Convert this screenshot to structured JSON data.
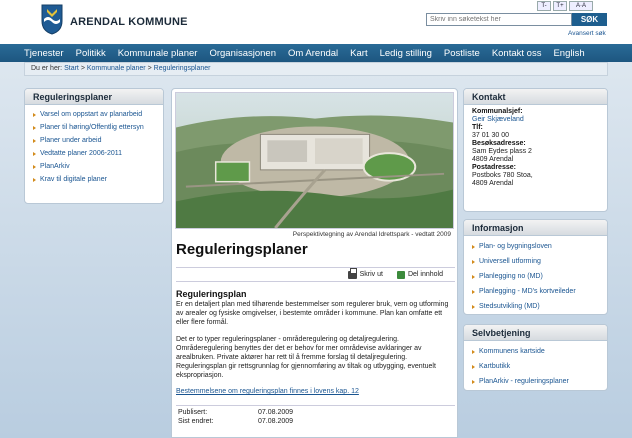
{
  "header": {
    "site_name": "ARENDAL KOMMUNE",
    "font_buttons": [
      "T-",
      "T+",
      "A·A"
    ],
    "search_placeholder": "Skriv inn søketekst her",
    "search_button": "SØK",
    "advanced_search": "Avansert søk"
  },
  "nav": {
    "items": [
      "Tjenester",
      "Politikk",
      "Kommunale planer",
      "Organisasjonen",
      "Om Arendal",
      "Kart",
      "Ledig stilling",
      "Postliste",
      "Kontakt oss",
      "English"
    ]
  },
  "breadcrumb": {
    "prefix": "Du er her:",
    "items": [
      "Start",
      "Kommunale planer",
      "Reguleringsplaner"
    ],
    "separator": ">"
  },
  "left_panel": {
    "title": "Reguleringsplaner",
    "items": [
      "Varsel om oppstart av planarbeid",
      "Planer til høring/Offentlig ettersyn",
      "Planer under arbeid",
      "Vedtatte planer 2006-2011",
      "PlanArkiv",
      "Krav til digitale planer"
    ]
  },
  "main": {
    "caption": "Perspektivtegning av Arendal Idrettspark - vedtatt 2009",
    "title": "Reguleringsplaner",
    "print_label": "Skriv ut",
    "share_label": "Del innhold",
    "subtitle": "Reguleringsplan",
    "para1": "Er en detaljert plan med tilhørende bestemmelser som regulerer bruk, vern og utforming av arealer og fysiske omgivelser, i bestemte områder i  kommune. Plan kan omfatte ett eller flere formål.",
    "para2": "Det er to typer reguleringsplaner - områderegulering og detaljregulering. Områderegulering benyttes der det er behov for mer områdevise avklaringer av arealbruken. Private aktører har rett til å fremme forslag til detaljregulering. Reguleringsplan gir rettsgrunnlag for gjennomføring av tiltak og utbygging, eventuelt ekspropriasjon.",
    "law_link": "Bestemmelsene om reguleringsplan finnes i lovens kap. 12",
    "published_label": "Publisert:",
    "published_value": "07.08.2009",
    "edited_label": "Sist endret:",
    "edited_value": "07.08.2009"
  },
  "contact": {
    "title": "Kontakt",
    "role_label": "Kommunalsjef:",
    "role_name": "Geir Skjæveland",
    "phone_label": "Tlf:",
    "phone": "37 01 30 00",
    "visit_label": "Besøksadresse:",
    "visit_line1": "Sam Eydes plass 2",
    "visit_line2": "4809 Arendal",
    "post_label": "Postadresse:",
    "post_line1": "Postboks 780 Stoa,",
    "post_line2": "4809 Arendal"
  },
  "info": {
    "title": "Informasjon",
    "items": [
      "Plan- og bygningsloven",
      "Universell utforming",
      "Planlegging no (MD)",
      "Planlegging - MD's kortveileder",
      "Stedsutvikling (MD)"
    ]
  },
  "selvbetjening": {
    "title": "Selvbetjening",
    "items": [
      "Kommunens kartside",
      "Kartbutikk",
      "PlanArkiv - reguleringsplaner"
    ]
  },
  "colors": {
    "nav": "#1d5680",
    "link": "#1a5591",
    "bullet": "#d28a1a"
  }
}
